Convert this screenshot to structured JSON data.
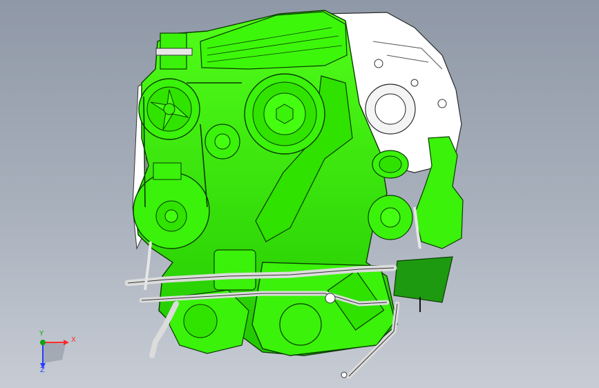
{
  "viewport": {
    "background_top": "#8f98a6",
    "background_bottom": "#c7ccd4"
  },
  "model": {
    "part_color": "#33ee00",
    "part_outline": "#0a3a00",
    "housing_color": "#ffffff",
    "hose_color": "#dcdcdc",
    "bracket_color": "#1e9a10"
  },
  "triad": {
    "x_label": "X",
    "y_label": "Y",
    "z_label": "Z",
    "x_color": "#ff2a2a",
    "y_color": "#0ea40e",
    "z_color": "#2a3cff"
  }
}
